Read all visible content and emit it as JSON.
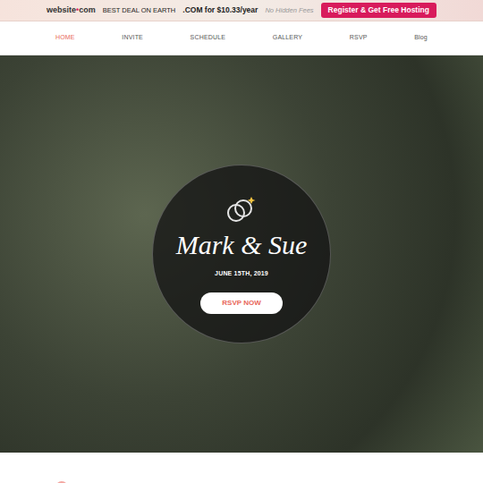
{
  "banner": {
    "logo_left": "website",
    "logo_right": "com",
    "deal": "BEST DEAL ON EARTH",
    "offer": ".COM for $10.33/year",
    "note": "No Hidden Fees",
    "button": "Register & Get Free Hosting"
  },
  "nav": {
    "items": [
      {
        "label": "HOME",
        "selected": true
      },
      {
        "label": "INVITE",
        "selected": false
      },
      {
        "label": "SCHEDULE",
        "selected": false
      },
      {
        "label": "GALLERY",
        "selected": false
      },
      {
        "label": "RSVP",
        "selected": false
      },
      {
        "label": "Blog",
        "selected": false
      }
    ]
  },
  "hero": {
    "names": "Mark & Sue",
    "date": "JUNE 15TH, 2019",
    "button": "RSVP NOW"
  }
}
